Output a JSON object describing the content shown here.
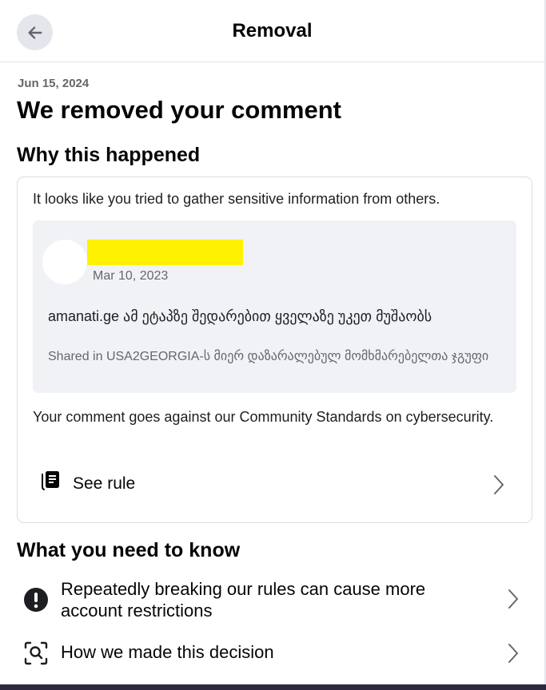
{
  "header": {
    "title": "Removal",
    "back_icon": "arrow-left-icon"
  },
  "notice": {
    "date": "Jun 15, 2024",
    "title": "We removed your comment"
  },
  "why": {
    "heading": "Why this happened",
    "intro": "It looks like you tried to gather sensitive information from others.",
    "comment": {
      "date": "Mar 10, 2023",
      "text": "amanati.ge ამ ეტაპზე შედარებით ყველაზე უკეთ მუშაობს",
      "shared": "Shared in USA2GEORGIA-ს მიერ დაზარალებულ მომხმარებელთა ჯგუფი",
      "redaction_color": "#fff200"
    },
    "outro": "Your comment goes against our Community Standards on cybersecurity.",
    "see_rule_label": "See rule"
  },
  "know": {
    "heading": "What you need to know",
    "items": [
      {
        "label": "Repeatedly breaking our rules can cause more account restrictions",
        "icon": "exclamation-circle-icon"
      },
      {
        "label": "How we made this decision",
        "icon": "magnify-scan-icon"
      }
    ]
  },
  "colors": {
    "text_primary": "#050505",
    "text_secondary": "#65676b",
    "comment_bg": "#f0f2f5",
    "button_bg": "#e4e6eb"
  }
}
